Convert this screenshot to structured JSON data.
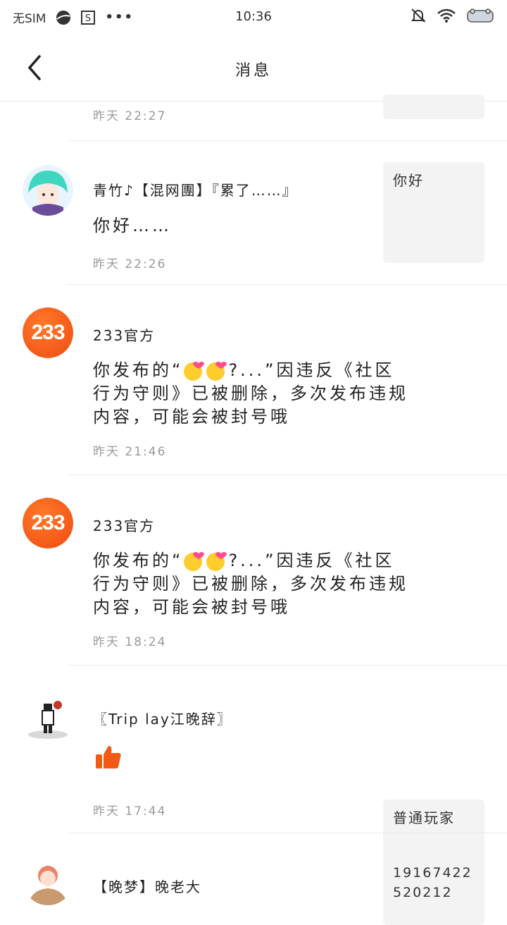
{
  "status_bar": {
    "carrier": "无SIM",
    "time": "10:36",
    "dots": "•••"
  },
  "header": {
    "title": "消息"
  },
  "messages": [
    {
      "time": "昨天 22:27"
    },
    {
      "name": "青竹♪【混网團】『累了……』",
      "text": "你好……",
      "time": "昨天 22:26",
      "thumb": "你好"
    },
    {
      "name": "233官方",
      "text_prefix": "你发布的“",
      "text_suffix": "?...”因违反《社区",
      "text_line2": "行为守则》已被删除，多次发布违规",
      "text_line3": "内容，可能会被封号哦",
      "time": "昨天 21:46",
      "avatar_label": "233"
    },
    {
      "name": "233官方",
      "text_prefix": "你发布的“",
      "text_suffix": "?...”因违反《社区",
      "text_line2": "行为守则》已被删除，多次发布违规",
      "text_line3": "内容，可能会被封号哦",
      "time": "昨天 18:24",
      "avatar_label": "233"
    },
    {
      "name": "〖Trip lay江晚辞〗",
      "time": "昨天 17:44",
      "thumb": "普通玩家"
    },
    {
      "name": "【晚梦】晚老大",
      "thumb": "19167422520212"
    }
  ],
  "colors": {
    "accent": "#f04b10",
    "thumb_bg": "#f3f3f3"
  }
}
